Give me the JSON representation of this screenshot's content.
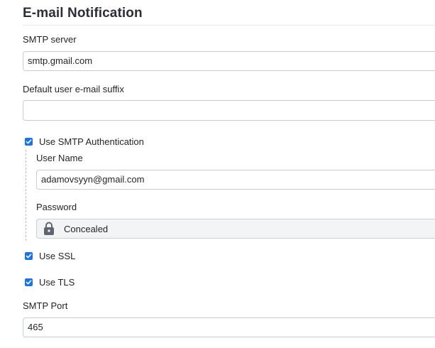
{
  "section": {
    "title": "E-mail Notification"
  },
  "smtp_server": {
    "label": "SMTP server",
    "value": "smtp.gmail.com"
  },
  "default_suffix": {
    "label": "Default user e-mail suffix",
    "value": ""
  },
  "smtp_auth": {
    "label": "Use SMTP Authentication",
    "checked": true,
    "username_label": "User Name",
    "username_value": "adamovsyyn@gmail.com",
    "password_label": "Password",
    "password_value": "Concealed",
    "password_icon": "lock-icon"
  },
  "use_ssl": {
    "label": "Use SSL",
    "checked": true
  },
  "use_tls": {
    "label": "Use TLS",
    "checked": true
  },
  "smtp_port": {
    "label": "SMTP Port",
    "value": "465"
  },
  "colors": {
    "checkbox": "#1a73e8",
    "concealed_bg": "#f3f4f5",
    "lock": "#5f6670"
  }
}
